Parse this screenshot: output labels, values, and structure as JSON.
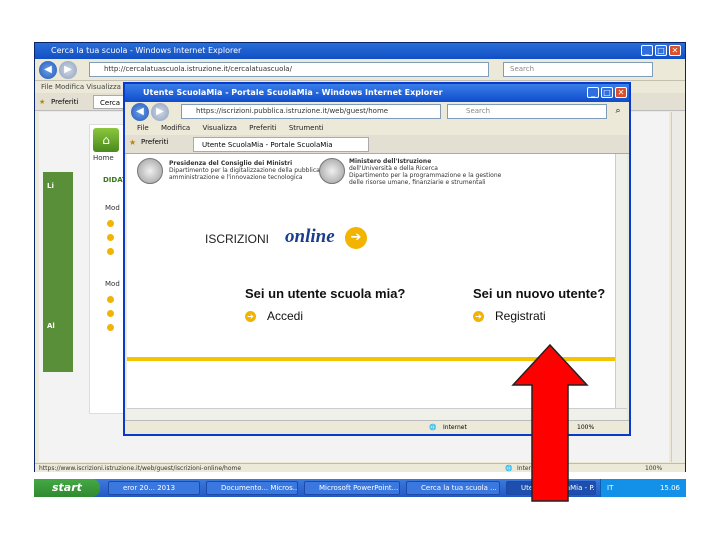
{
  "back_window": {
    "title": "Cerca la tua scuola - Windows Internet Explorer",
    "address": "http://cercalatuascuola.istruzione.it/cercalatuascuola/",
    "search_placeholder": "Search",
    "menu": "File   Modifica   Visualizza   Preferiti   Strumenti",
    "tab_favorites": "Preferiti",
    "tab_page": "Cerca",
    "status_url": "https://www.iscrizioni.istruzione.it/web/guest/iscrizioni-online/home",
    "status_zone": "Internet",
    "status_zoom": "100%",
    "page_text": {
      "home": "Home",
      "didattica": "DIDAT",
      "section_mod1": "Mod",
      "section_mod2": "Mod",
      "side_li": "Li",
      "side_al": "Al"
    }
  },
  "front_window": {
    "title": "Utente ScuolaMia - Portale ScuolaMia - Windows Internet Explorer",
    "address": "https://iscrizioni.pubblica.istruzione.it/web/guest/home",
    "search_placeholder": "Search",
    "menu": [
      "File",
      "Modifica",
      "Visualizza",
      "Preferiti",
      "Strumenti"
    ],
    "tab_favorites": "Preferiti",
    "tab_page": "Utente ScuolaMia - Portale ScuolaMia",
    "presidenza_line1": "Presidenza del Consiglio dei Ministri",
    "presidenza_line2": "Dipartimento per la digitalizzazione della pubblica",
    "presidenza_line3": "amministrazione e l'innovazione tecnologica",
    "ministero_line1": "Ministero dell'Istruzione",
    "ministero_line2": "dell'Università e della Ricerca",
    "ministero_line3": "Dipartimento per la programmazione e la gestione",
    "ministero_line4": "delle risorse umane, finanziarie e strumentali",
    "logo_word1": "ISCRIZIONI",
    "logo_word2": "online",
    "question_existing": "Sei un utente scuola mia?",
    "link_login": "Accedi",
    "question_new": "Sei un nuovo utente?",
    "link_register": "Registrati",
    "status_zone": "Internet",
    "status_zoom": "100%"
  },
  "taskbar": {
    "start": "start",
    "items": [
      "eror 20... 2013",
      "Documento... Micros...",
      "Microsoft PowerPoint...",
      "Cerca la tua scuola ...",
      "Utente ScuolaMia - P..."
    ],
    "language": "IT",
    "clock": "15.06"
  },
  "colors": {
    "xp_blue": "#2458c4",
    "accent_yellow": "#f5c400",
    "arrow_red": "#ff0000"
  }
}
